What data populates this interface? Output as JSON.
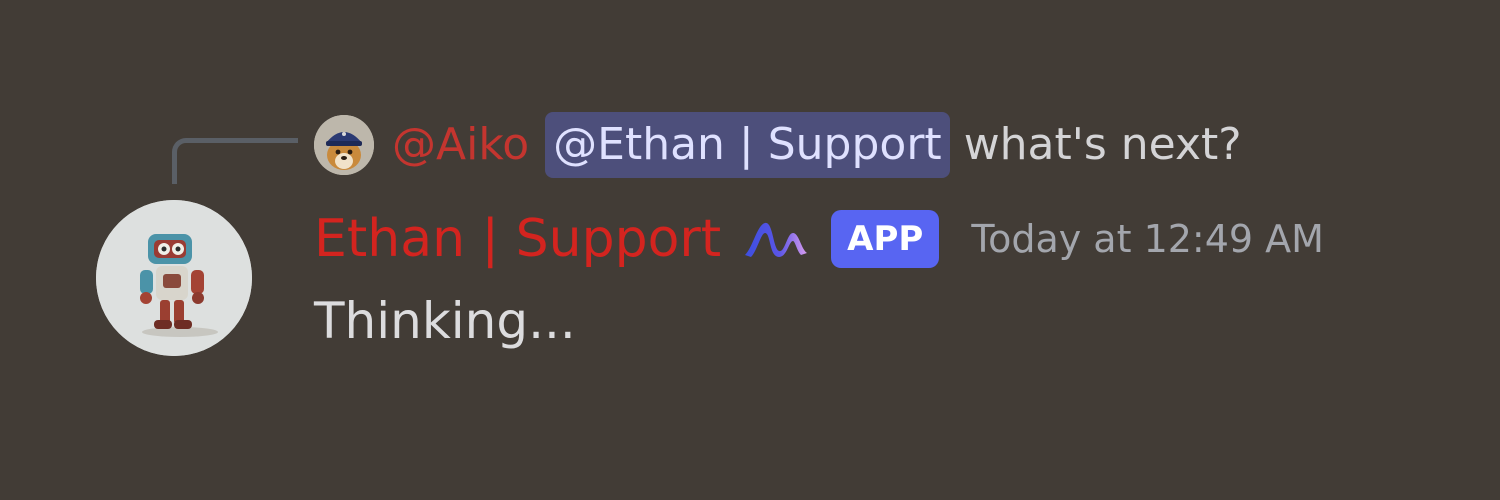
{
  "reply": {
    "author": "@Aiko",
    "mention": "@Ethan | Support",
    "text": "what's next?",
    "avatar_icon": "dog-with-cap-avatar"
  },
  "message": {
    "author": "Ethan | Support",
    "role_icon": "wave-role-icon",
    "badge": "APP",
    "timestamp": "Today at 12:49 AM",
    "body": "Thinking...",
    "avatar_icon": "robot-avatar"
  },
  "colors": {
    "background": "#423c36",
    "reply_author": "#c4352f",
    "mention_bg": "#4d4f7b",
    "author": "#d4241f",
    "app_badge": "#5865f2",
    "timestamp": "#a3a6ad",
    "body_text": "#dcdcde"
  }
}
